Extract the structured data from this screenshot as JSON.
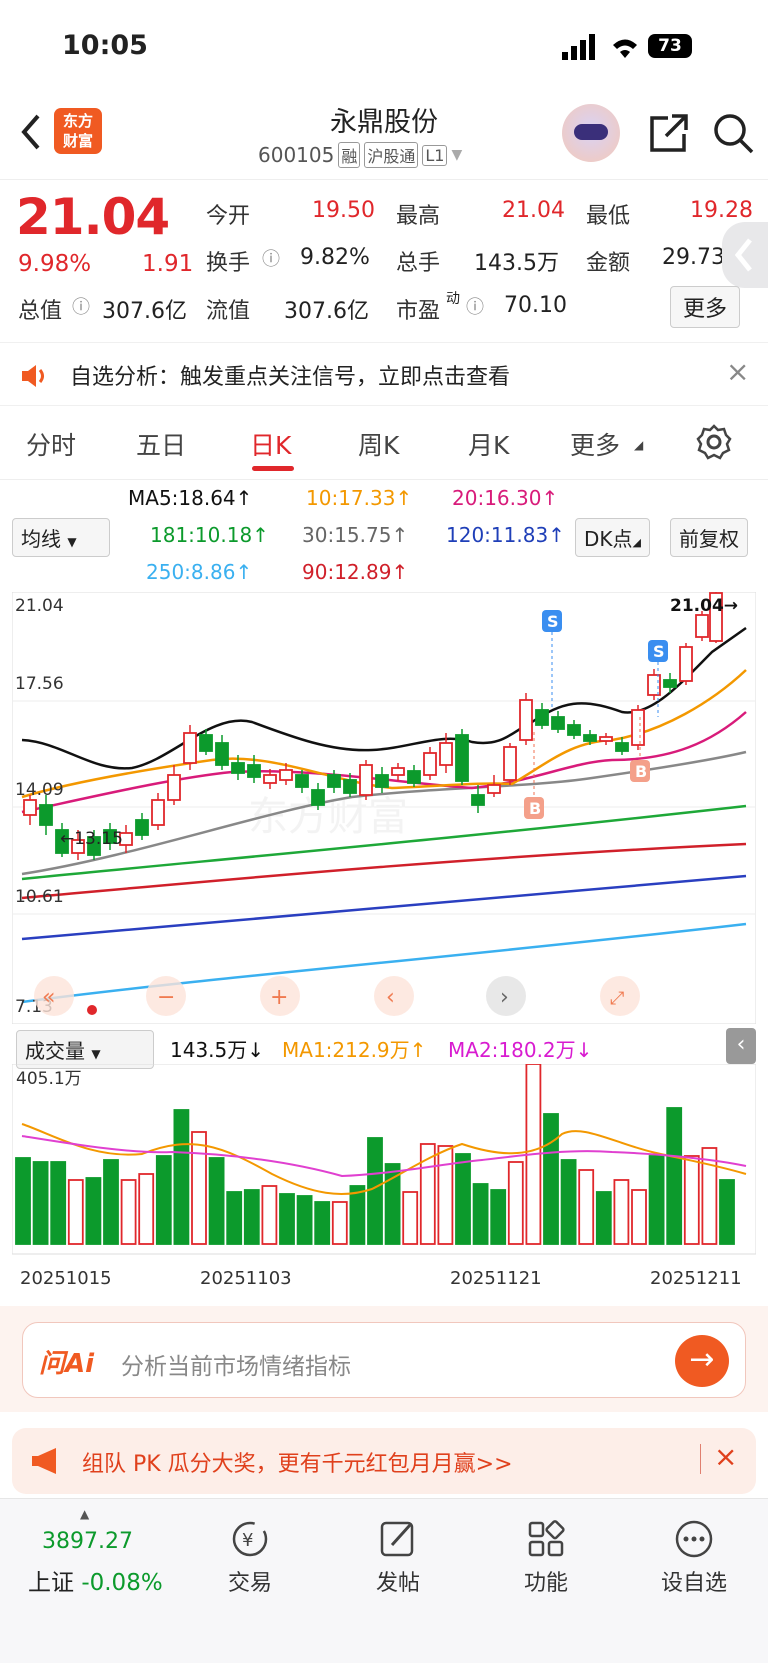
{
  "status": {
    "time": "10:05",
    "battery": "73"
  },
  "header": {
    "title": "永鼎股份",
    "code": "600105",
    "tag_rong": "融",
    "tag_hgt": "沪股通",
    "tag_l1": "L1",
    "logo_line1": "东方",
    "logo_line2": "财富"
  },
  "quote": {
    "price": "21.04",
    "change_pct": "9.98%",
    "change": "1.91",
    "items": [
      {
        "label": "今开",
        "value": "19.50"
      },
      {
        "label": "最高",
        "value": "21.04"
      },
      {
        "label": "最低",
        "value": "19.28"
      },
      {
        "label": "换手",
        "value": "9.82%"
      },
      {
        "label": "总手",
        "value": "143.5万"
      },
      {
        "label": "金额",
        "value": "29.73"
      },
      {
        "label": "总值",
        "value": "307.6亿"
      },
      {
        "label": "流值",
        "value": "307.6亿"
      },
      {
        "label": "市盈",
        "value": "70.10"
      }
    ],
    "pe_sup": "动",
    "more": "更多"
  },
  "banner": {
    "text": "自选分析：触发重点关注信号，立即点击查看",
    "close": "×"
  },
  "tabs": [
    "分时",
    "五日",
    "日K",
    "周K",
    "月K",
    "更多"
  ],
  "ma": {
    "select": "均线",
    "ma5": "MA5:18.64↑",
    "ma10": "10:17.33↑",
    "ma20": "20:16.30↑",
    "ma181": "181:10.18↑",
    "ma30": "30:15.75↑",
    "ma120": "120:11.83↑",
    "ma250": "250:8.86↑",
    "ma90": "90:12.89↑",
    "dk": "DK点",
    "fq": "前复权"
  },
  "kchart": {
    "y_labels": [
      "21.04",
      "17.56",
      "14.09",
      "10.61",
      "7.13"
    ],
    "last_label": "21.04→",
    "low_label": "←13.15",
    "signal_s": "S",
    "signal_b": "B"
  },
  "volume": {
    "select": "成交量",
    "current": "143.5万↓",
    "ma1": "MA1:212.9万↑",
    "ma2": "MA2:180.2万↓",
    "max_label": "405.1万",
    "dates": [
      "20251015",
      "20251103",
      "20251121",
      "20251211"
    ]
  },
  "ai": {
    "logo": "问Ai",
    "placeholder": "分析当前市场情绪指标"
  },
  "promo": {
    "text": "组队 PK 瓜分大奖，更有千元红包月月赢>>",
    "close": "×"
  },
  "nav": {
    "index_value": "3897.27",
    "index_name": "上证",
    "index_change": "-0.08%",
    "items": [
      "交易",
      "发帖",
      "功能",
      "设自选"
    ]
  },
  "colors": {
    "up": "#e0272b",
    "down": "#0c9a2c",
    "accent": "#f05a22"
  }
}
